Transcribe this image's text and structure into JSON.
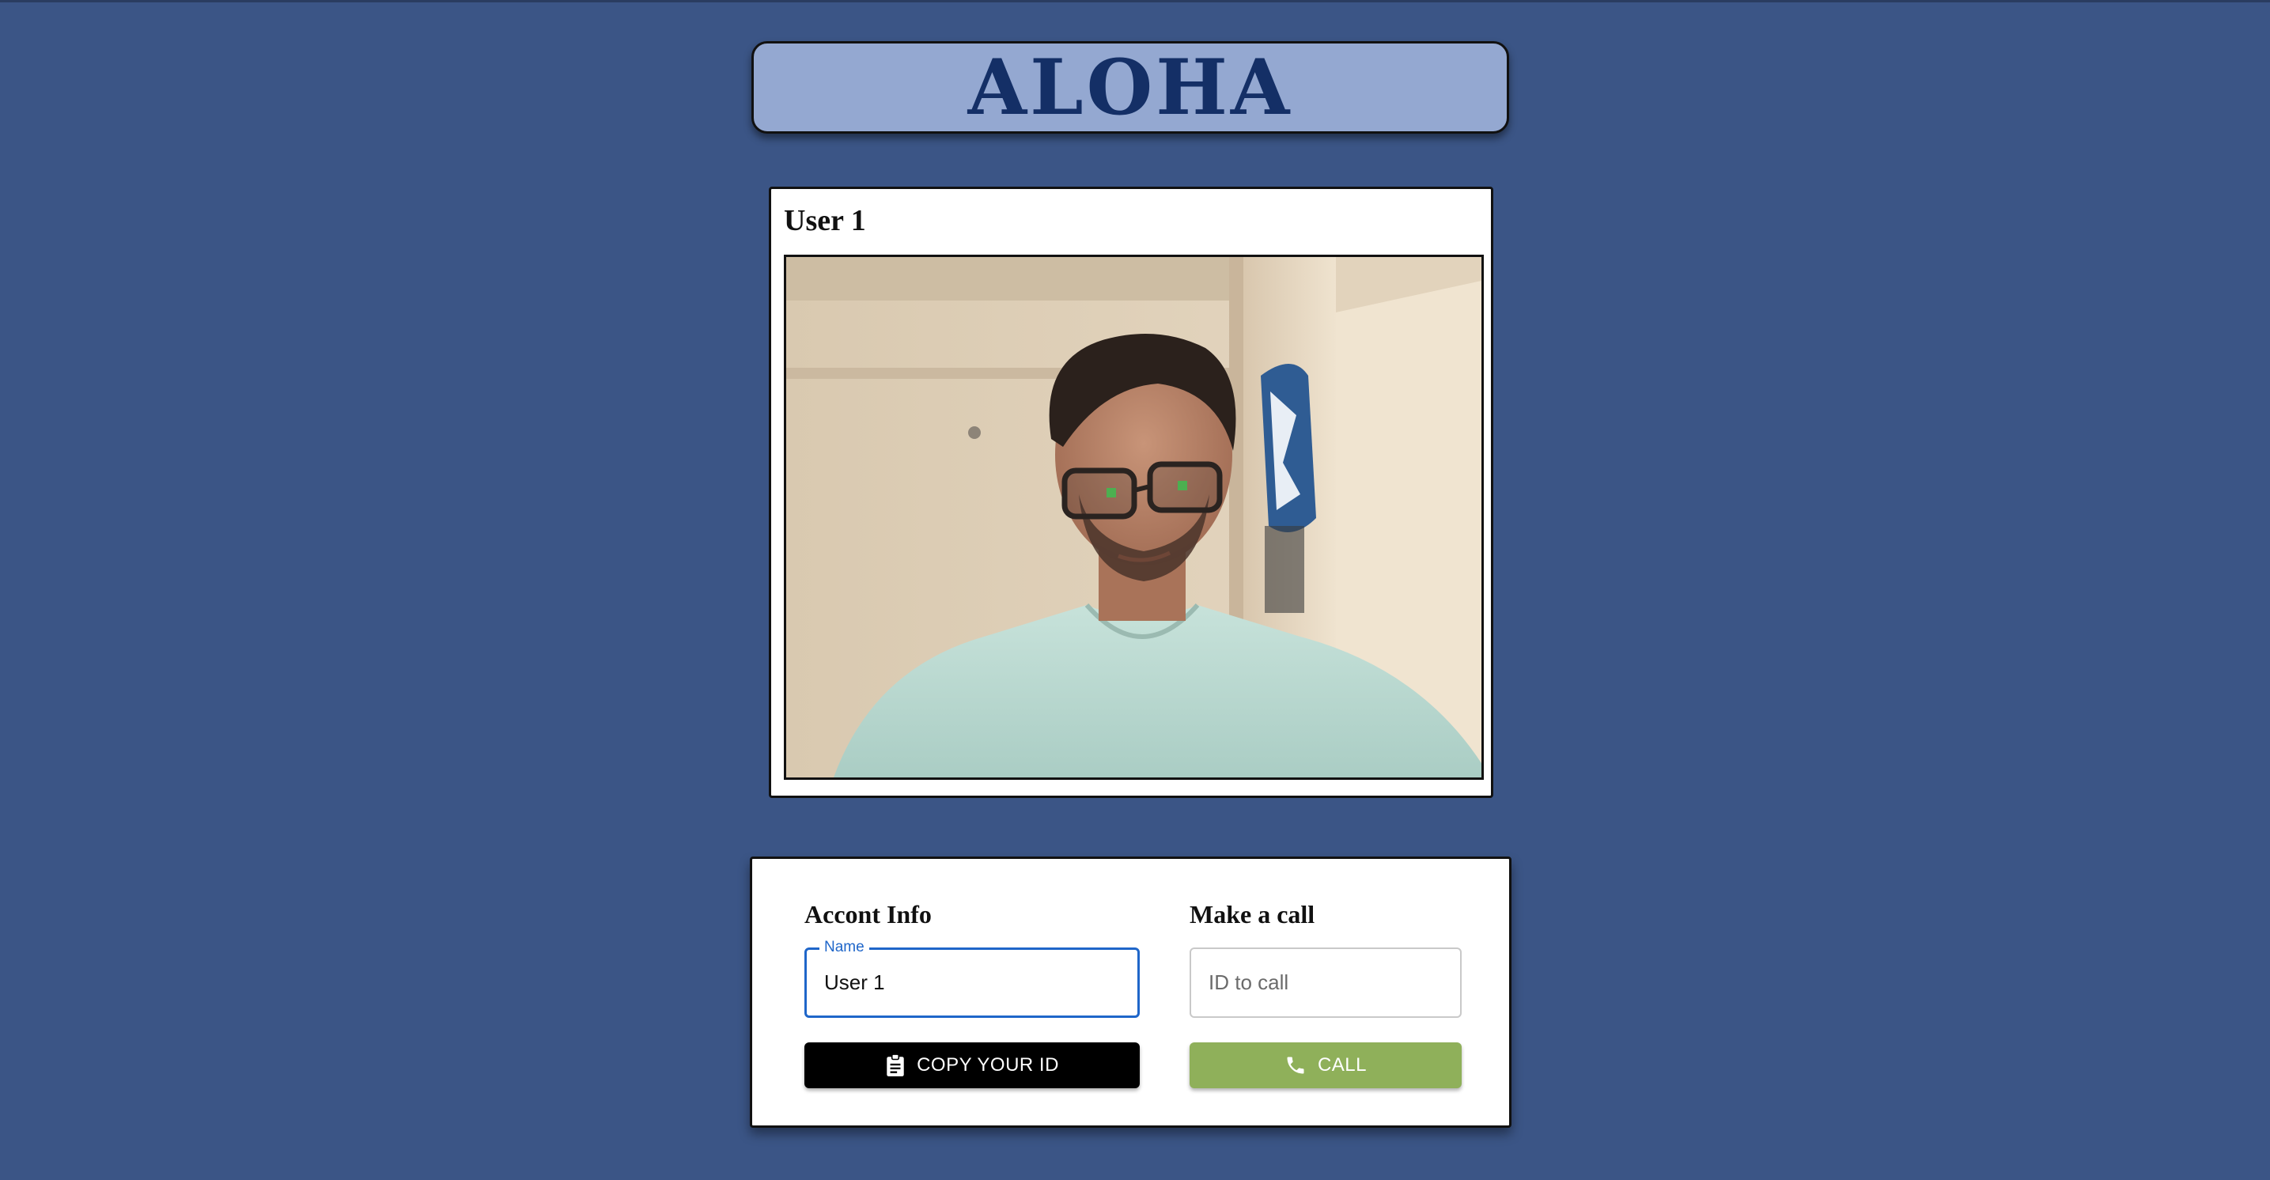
{
  "app": {
    "title": "ALOHA"
  },
  "video": {
    "user_name": "User 1"
  },
  "account_info": {
    "heading": "Accont Info",
    "name_label": "Name",
    "name_value": "User 1",
    "copy_button_label": "COPY YOUR ID",
    "copy_icon": "clipboard-icon"
  },
  "make_call": {
    "heading": "Make a call",
    "id_placeholder": "ID to call",
    "id_value": "",
    "call_button_label": "CALL",
    "call_icon": "phone-icon"
  },
  "colors": {
    "background": "#3b5586",
    "title_bar": "#94a8d1",
    "title_text": "#142f66",
    "focus_blue": "#1f66c9",
    "call_button": "#8fb05a",
    "copy_button": "#000000"
  }
}
